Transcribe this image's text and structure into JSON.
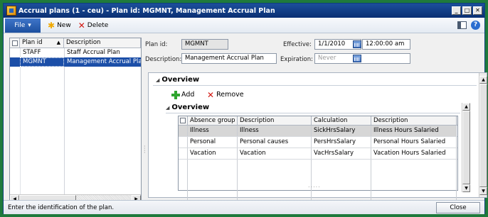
{
  "window": {
    "title": "Accrual plans (1 - ceu) - Plan id: MGMNT, Management Accrual Plan"
  },
  "toolbar": {
    "file_label": "File",
    "new_label": "New",
    "delete_label": "Delete"
  },
  "plan_list": {
    "headers": [
      "Plan id",
      "Description"
    ],
    "rows": [
      {
        "id": "STAFF",
        "description": "Staff Accrual Plan"
      },
      {
        "id": "MGMNT",
        "description": "Management Accrual Plan",
        "selected": true
      }
    ]
  },
  "header_fields": {
    "plan_id_label": "Plan id:",
    "plan_id_value": "MGMNT",
    "description_label": "Description:",
    "description_value": "Management Accrual Plan",
    "effective_label": "Effective:",
    "effective_date": "1/1/2010",
    "effective_time": "12:00:00 am",
    "expiration_label": "Expiration:",
    "expiration_value": "Never"
  },
  "overview_section": {
    "title": "Overview",
    "add_label": "Add",
    "remove_label": "Remove"
  },
  "inner_section": {
    "title": "Overview",
    "headers": [
      "Absence group",
      "Description",
      "Calculation",
      "Description"
    ],
    "rows": [
      {
        "group": "Illness",
        "description": "Illness",
        "calculation": "SickHrsSalary",
        "calc_description": "Illness Hours Salaried",
        "selected": true
      },
      {
        "group": "Personal",
        "description": "Personal causes",
        "calculation": "PersHrsSalary",
        "calc_description": "Personal Hours Salaried"
      },
      {
        "group": "Vacation",
        "description": "Vacation",
        "calculation": "VacHrsSalary",
        "calc_description": "Vacation Hours Salaried"
      }
    ],
    "footer_dots": "....."
  },
  "status_bar": {
    "text": "Enter the identification of the plan.",
    "close_label": "Close"
  },
  "colors": {
    "frame": "#1f7a3c",
    "title_bar": "#0a2f73",
    "selection": "#1c4fa8"
  }
}
